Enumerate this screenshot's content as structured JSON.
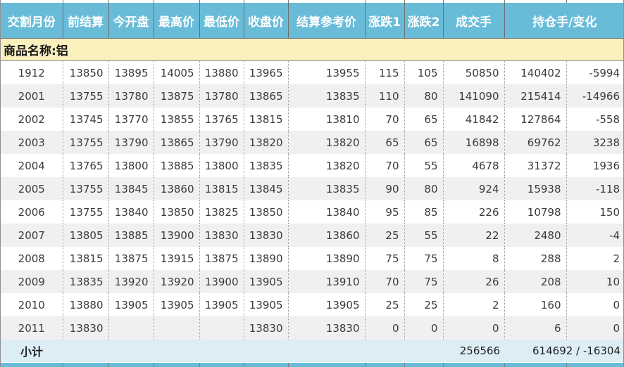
{
  "table": {
    "headers": [
      "交割月份",
      "前结算",
      "今开盘",
      "最高价",
      "最低价",
      "收盘价",
      "结算参考价",
      "涨跌1",
      "涨跌2",
      "成交手",
      "持仓手/变化"
    ],
    "commodity_label": "商品名称:铝",
    "rows": [
      [
        "1912",
        "13850",
        "13895",
        "14005",
        "13880",
        "13965",
        "13955",
        "115",
        "105",
        "50850",
        "140402",
        "-5994"
      ],
      [
        "2001",
        "13755",
        "13780",
        "13875",
        "13780",
        "13865",
        "13835",
        "110",
        "80",
        "141090",
        "215414",
        "-14966"
      ],
      [
        "2002",
        "13745",
        "13770",
        "13855",
        "13765",
        "13815",
        "13810",
        "70",
        "65",
        "41842",
        "127864",
        "-558"
      ],
      [
        "2003",
        "13755",
        "13790",
        "13865",
        "13790",
        "13820",
        "13820",
        "65",
        "65",
        "16898",
        "69762",
        "3238"
      ],
      [
        "2004",
        "13765",
        "13800",
        "13885",
        "13800",
        "13835",
        "13820",
        "70",
        "55",
        "4678",
        "31372",
        "1936"
      ],
      [
        "2005",
        "13755",
        "13845",
        "13860",
        "13815",
        "13845",
        "13835",
        "90",
        "80",
        "924",
        "15938",
        "-118"
      ],
      [
        "2006",
        "13755",
        "13840",
        "13850",
        "13825",
        "13850",
        "13840",
        "95",
        "85",
        "226",
        "10798",
        "150"
      ],
      [
        "2007",
        "13805",
        "13885",
        "13900",
        "13830",
        "13830",
        "13860",
        "25",
        "55",
        "22",
        "2480",
        "-4"
      ],
      [
        "2008",
        "13815",
        "13875",
        "13915",
        "13875",
        "13890",
        "13890",
        "75",
        "75",
        "8",
        "288",
        "2"
      ],
      [
        "2009",
        "13835",
        "13920",
        "13920",
        "13900",
        "13905",
        "13910",
        "70",
        "75",
        "26",
        "208",
        "10"
      ],
      [
        "2010",
        "13880",
        "13905",
        "13905",
        "13905",
        "13905",
        "13905",
        "25",
        "25",
        "2",
        "160",
        "0"
      ],
      [
        "2011",
        "13830",
        "",
        "",
        "",
        "13830",
        "13830",
        "0",
        "0",
        "0",
        "6",
        "0"
      ]
    ],
    "subtotal": {
      "label": "小计",
      "volume": "256566",
      "oi_change": "614692 / -16304"
    }
  },
  "colors": {
    "header_bg": "#69BCD8",
    "header_text": "#FFFFFF",
    "commodity_bg": "#FAF0BE",
    "row_alt_bg": "#F0F0F0",
    "subtotal_bg": "#DCEDF5",
    "text": "#3B3B3B"
  }
}
